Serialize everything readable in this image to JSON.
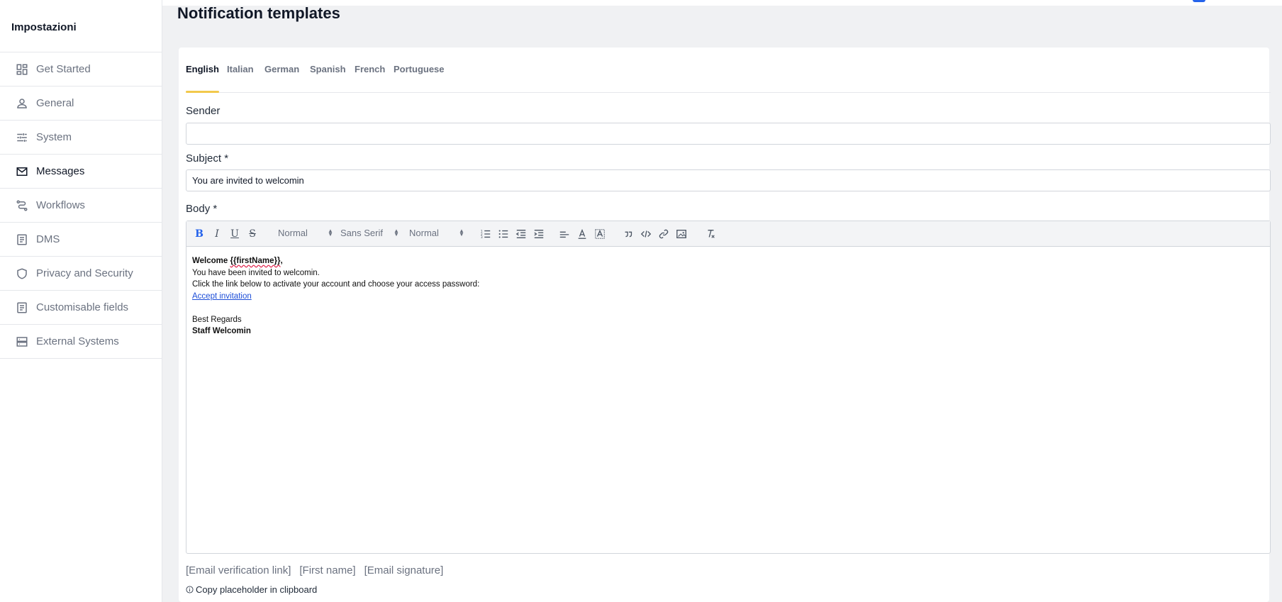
{
  "sidebar": {
    "title": "Impostazioni",
    "items": [
      {
        "label": "Get Started",
        "icon": "dashboard-icon",
        "active": false
      },
      {
        "label": "General",
        "icon": "person-icon",
        "active": false
      },
      {
        "label": "System",
        "icon": "sliders-icon",
        "active": false
      },
      {
        "label": "Messages",
        "icon": "mail-icon",
        "active": true
      },
      {
        "label": "Workflows",
        "icon": "route-icon",
        "active": false
      },
      {
        "label": "DMS",
        "icon": "document-icon",
        "active": false
      },
      {
        "label": "Privacy and Security",
        "icon": "shield-icon",
        "active": false
      },
      {
        "label": "Customisable fields",
        "icon": "document-icon",
        "active": false
      },
      {
        "label": "External Systems",
        "icon": "storage-icon",
        "active": false
      }
    ]
  },
  "page": {
    "title": "Notification templates"
  },
  "tabs": [
    {
      "label": "English",
      "active": true
    },
    {
      "label": "Italian",
      "active": false
    },
    {
      "label": "German",
      "active": false
    },
    {
      "label": "Spanish",
      "active": false
    },
    {
      "label": "French",
      "active": false
    },
    {
      "label": "Portuguese",
      "active": false
    }
  ],
  "form": {
    "sender_label": "Sender",
    "sender_value": "",
    "subject_label": "Subject *",
    "subject_value": "You are invited to welcomin",
    "body_label": "Body *"
  },
  "toolbar": {
    "header_select": "Normal",
    "font_select": "Sans Serif",
    "size_select": "Normal"
  },
  "body": {
    "greeting_prefix": "Welcome ",
    "greeting_var": "{{firstName}}",
    "greeting_suffix": ",",
    "line2": "You have been invited to welcomin.",
    "line3": "Click the link below to activate your account and choose your access password:",
    "link_text": "Accept invitation",
    "regards": "Best Regards",
    "signature": "Staff Welcomin"
  },
  "placeholders": [
    "[Email verification link]",
    "[First name]",
    "[Email signature]"
  ],
  "copy_hint": "Copy placeholder in clipboard",
  "colors": {
    "accent_yellow": "#f2c94c",
    "link_blue": "#1d4ed8",
    "page_bg": "#f0f1f3"
  }
}
